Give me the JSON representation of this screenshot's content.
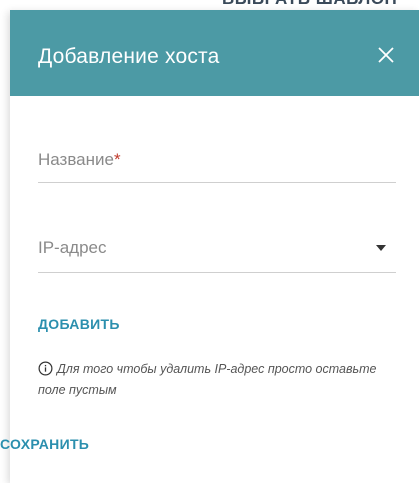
{
  "background": {
    "top_text": "ВЫБРАТЬ ШАБЛОН"
  },
  "dialog": {
    "title": "Добавление хоста",
    "close_icon": "close-icon",
    "header_color": "#4c9aa5"
  },
  "form": {
    "name_label": "Название",
    "name_required_mark": "*",
    "ip_label": "IP-адрес"
  },
  "actions": {
    "add_label": "ДОБАВИТЬ",
    "save_label": "СОХРАНИТЬ",
    "accent_color": "#2b8fae"
  },
  "hint": {
    "icon": "info-icon",
    "text": "Для того чтобы удалить IP-адрес просто оставьте поле пустым"
  }
}
